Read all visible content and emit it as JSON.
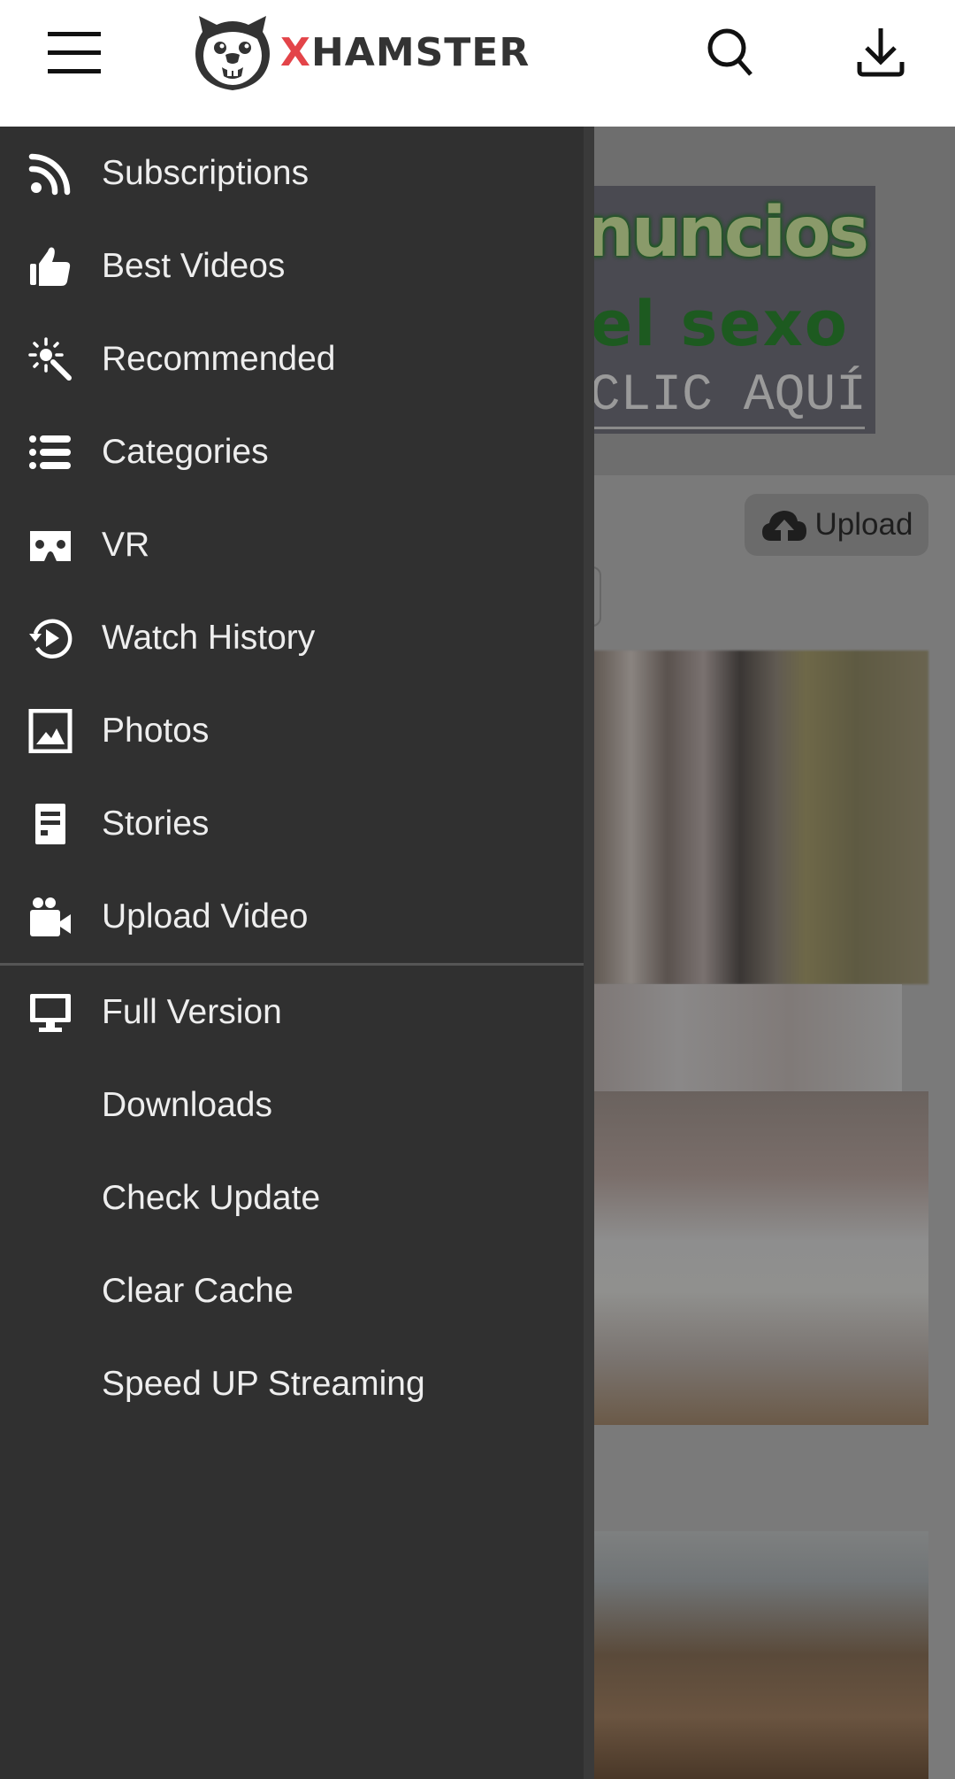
{
  "header": {
    "menu_icon": "hamburger-menu-icon",
    "logo": {
      "prefix": "X",
      "rest": "HAMSTER",
      "accent_color": "#e34449",
      "text_color": "#333333",
      "mascot_icon": "hamster-mascot-icon"
    },
    "search_icon": "search-icon",
    "download_icon": "download-icon"
  },
  "drawer": {
    "background": "#303030",
    "primary_items": [
      {
        "label": "Subscriptions",
        "icon": "rss-icon"
      },
      {
        "label": "Best Videos",
        "icon": "thumbs-up-icon"
      },
      {
        "label": "Recommended",
        "icon": "magic-wand-icon"
      },
      {
        "label": "Categories",
        "icon": "list-icon"
      },
      {
        "label": "VR",
        "icon": "vr-headset-icon"
      },
      {
        "label": "Watch History",
        "icon": "history-play-icon"
      },
      {
        "label": "Photos",
        "icon": "image-icon"
      },
      {
        "label": "Stories",
        "icon": "document-icon"
      },
      {
        "label": "Upload Video",
        "icon": "video-camera-icon"
      }
    ],
    "secondary_items": [
      {
        "label": "Full Version",
        "icon": "desktop-monitor-icon"
      },
      {
        "label": "Downloads"
      },
      {
        "label": "Check Update"
      },
      {
        "label": "Clear Cache"
      },
      {
        "label": "Speed UP Streaming"
      }
    ]
  },
  "background_page": {
    "ad": {
      "line1": "nuncios",
      "line2": "el sexo",
      "line3": "CLIC AQUÍ"
    },
    "upload_button": {
      "label": "Upload",
      "icon": "cloud-upload-icon"
    }
  }
}
